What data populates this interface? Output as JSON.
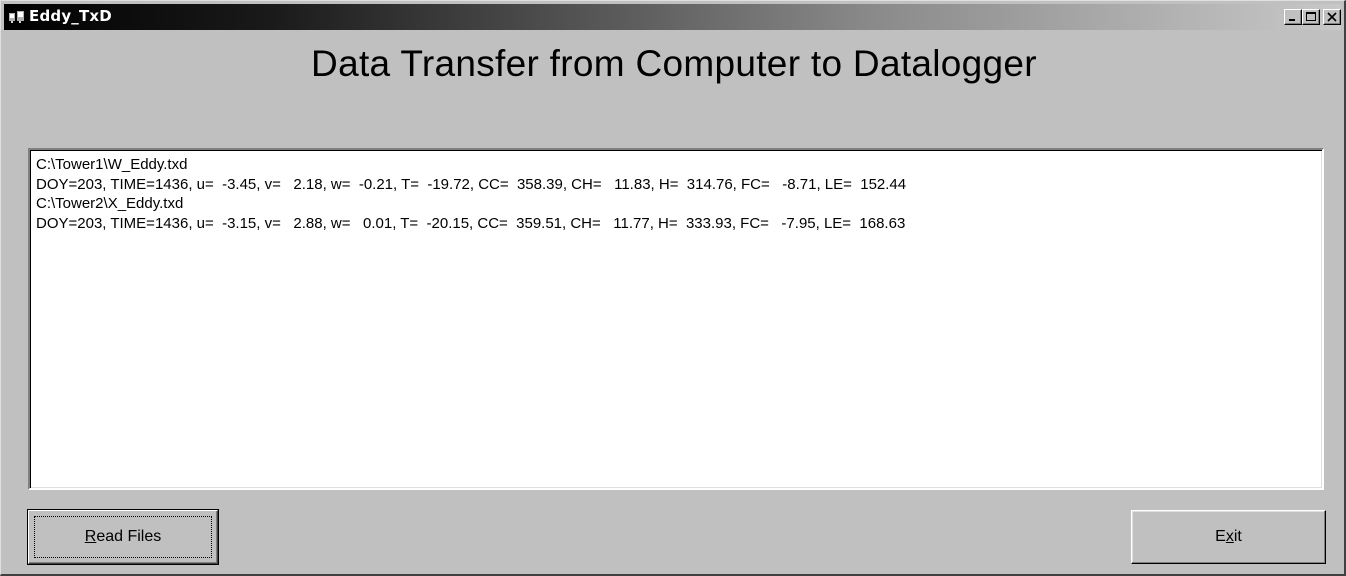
{
  "window": {
    "title": "Eddy_TxD",
    "icon": "app-icon"
  },
  "title_controls": {
    "minimize": "minimize-icon",
    "maximize": "maximize-icon",
    "close": "close-icon"
  },
  "heading": "Data Transfer from Computer to Datalogger",
  "output": {
    "lines": [
      "C:\\Tower1\\W_Eddy.txd",
      "DOY=203, TIME=1436, u=  -3.45, v=   2.18, w=  -0.21, T=  -19.72, CC=  358.39, CH=   11.83, H=  314.76, FC=   -8.71, LE=  152.44",
      "C:\\Tower2\\X_Eddy.txd",
      "DOY=203, TIME=1436, u=  -3.15, v=   2.88, w=   0.01, T=  -20.15, CC=  359.51, CH=   11.77, H=  333.93, FC=   -7.95, LE=  168.63"
    ]
  },
  "buttons": {
    "read_first": "R",
    "read_rest": "ead Files",
    "exit_first": "E",
    "exit_mnem": "x",
    "exit_rest": "it"
  }
}
